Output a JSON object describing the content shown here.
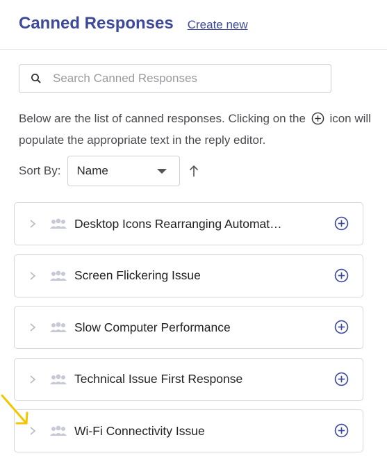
{
  "header": {
    "title": "Canned Responses",
    "create_label": "Create new"
  },
  "search": {
    "placeholder": "Search Canned Responses",
    "value": ""
  },
  "description": {
    "before_icon": "Below are the list of canned responses. Clicking on the",
    "after_icon": "icon will populate the appropriate text in the reply editor."
  },
  "sort": {
    "label": "Sort By:",
    "selected": "Name",
    "direction": "ascending"
  },
  "responses": [
    {
      "label": "Desktop Icons Rearranging Automati…"
    },
    {
      "label": "Screen Flickering Issue"
    },
    {
      "label": "Slow Computer Performance"
    },
    {
      "label": "Technical Issue First Response"
    },
    {
      "label": "Wi-Fi Connectivity Issue"
    }
  ],
  "colors": {
    "accent": "#3d4a9c",
    "annotation_arrow": "#f2c600"
  },
  "icons": {
    "search": "search-icon",
    "add": "plus-circle-icon",
    "expand": "chevron-right-icon",
    "group": "group-icon",
    "sort": "arrow-up-icon"
  }
}
